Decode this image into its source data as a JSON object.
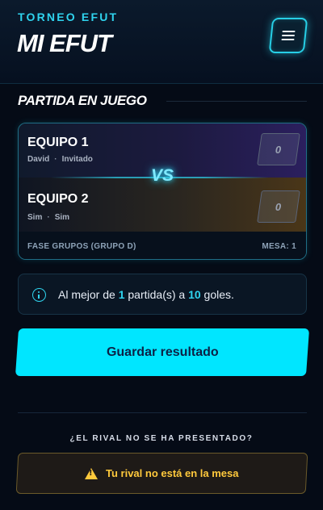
{
  "header": {
    "subtitle": "TORNEO EFUT",
    "title": "MI EFUT",
    "menu_icon": "hamburger-menu-icon"
  },
  "section": {
    "title": "PARTIDA EN JUEGO"
  },
  "match": {
    "vs": "VS",
    "team1": {
      "name": "EQUIPO 1",
      "player1": "David",
      "separator": "·",
      "player2": "Invitado",
      "score": "0"
    },
    "team2": {
      "name": "EQUIPO 2",
      "player1": "Sim",
      "separator": "·",
      "player2": "Sim",
      "score": "0"
    },
    "phase": "FASE GRUPOS (GRUPO D)",
    "table": "MESA: 1"
  },
  "info": {
    "icon": "info-icon",
    "prefix": "Al mejor de ",
    "matches": "1",
    "middle": " partida(s) a ",
    "goals": "10",
    "suffix": " goles."
  },
  "actions": {
    "save_label": "Guardar resultado"
  },
  "rival": {
    "question": "¿EL RIVAL NO SE HA PRESENTADO?",
    "button_label": "Tu rival no está en la mesa",
    "icon": "warning-icon"
  },
  "colors": {
    "accent": "#00e6ff",
    "warning": "#ffc93c",
    "background": "#050b16"
  }
}
